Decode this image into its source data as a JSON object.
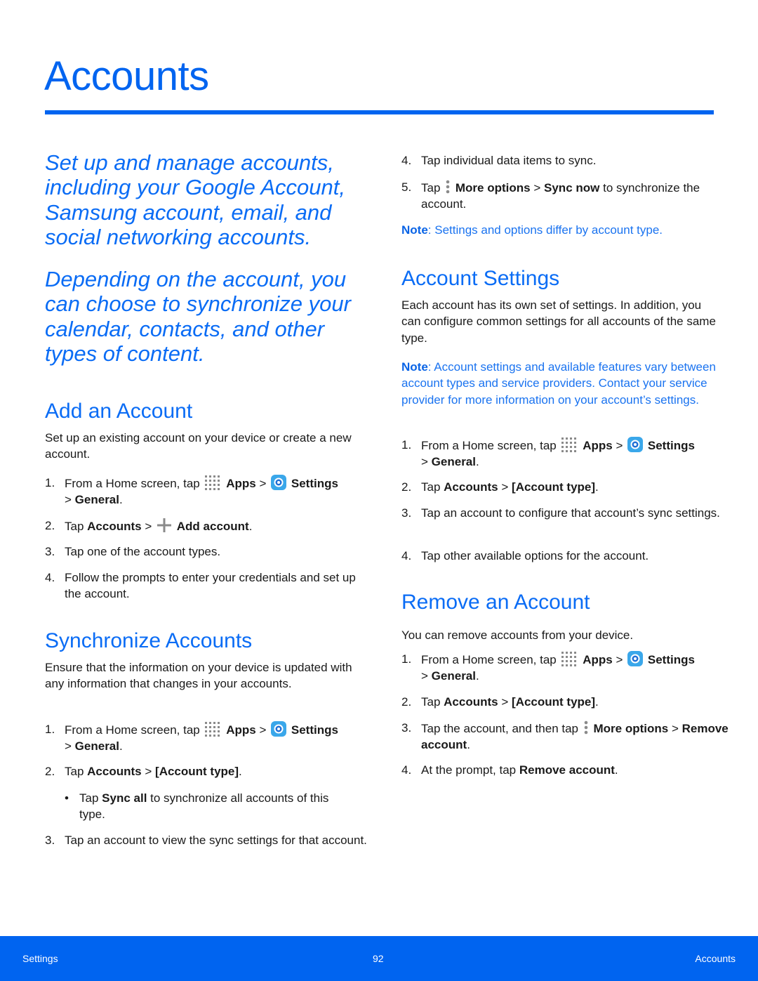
{
  "page": {
    "title": "Accounts",
    "accent_color": "#0064f0",
    "intro": [
      "Set up and manage accounts, including your Google Account, Samsung account, email, and social networking accounts.",
      "Depending on the account, you can choose to synchronize your calendar, contacts, and other types of content."
    ]
  },
  "add_account": {
    "heading": "Add an Account",
    "desc": "Set up an existing account on your device or create a new account.",
    "steps": {
      "s1": {
        "num": "1.",
        "pre": "From a Home screen, tap",
        "apps": "Apps",
        "sep": ">",
        "settings": "Settings",
        "sep2": ">",
        "general": "General",
        "end": "."
      },
      "s2": {
        "num": "2.",
        "pre": "Tap",
        "accounts": "Accounts",
        "sep": ">",
        "add": "Add account",
        "end": "."
      },
      "s3": {
        "num": "3.",
        "text": "Tap one of the account types."
      },
      "s4": {
        "num": "4.",
        "text": "Follow the prompts to enter your credentials and set up the account."
      }
    }
  },
  "sync": {
    "heading": "Synchronize Accounts",
    "desc": "Ensure that the information on your device is updated with any information that changes in your accounts.",
    "steps": {
      "s1": {
        "num": "1.",
        "pre": "From a Home screen, tap",
        "apps": "Apps",
        "sep": ">",
        "settings": "Settings",
        "sep2": ">",
        "general": "General",
        "end": "."
      },
      "s2": {
        "num": "2.",
        "pre": "Tap",
        "accounts": "Accounts",
        "sep": ">",
        "type": "[Account type]",
        "end": "."
      },
      "bullet": {
        "dot": "•",
        "pre": "Tap",
        "bold": "Sync all",
        "post": "to synchronize all accounts of this type."
      },
      "s3": {
        "num": "3.",
        "text": "Tap an account to view the sync settings for that account."
      },
      "s4": {
        "num": "4.",
        "text": "Tap individual data items to sync."
      },
      "s5": {
        "num": "5.",
        "pre": "Tap",
        "more": "More options",
        "sep": ">",
        "sync_now": "Sync now",
        "post": "to synchronize the account."
      }
    },
    "note_label": "Note",
    "note_text": ": Settings and options differ by account type."
  },
  "account_settings": {
    "heading": "Account Settings",
    "desc": "Each account has its own set of settings. In addition, you can configure common settings for all accounts of the same type.",
    "note_label": "Note",
    "note_text": ": Account settings and available features vary between account types and service providers. Contact your service provider for more information on your account’s settings.",
    "steps": {
      "s1": {
        "num": "1.",
        "pre": "From a Home screen, tap",
        "apps": "Apps",
        "sep": ">",
        "settings": "Settings",
        "sep2": ">",
        "general": "General",
        "end": "."
      },
      "s2": {
        "num": "2.",
        "pre": "Tap",
        "accounts": "Accounts",
        "sep": ">",
        "type": "[Account type]",
        "end": "."
      },
      "s3": {
        "num": "3.",
        "text": "Tap an account to configure that account’s sync settings."
      },
      "s4": {
        "num": "4.",
        "text": "Tap other available options for the account."
      }
    }
  },
  "remove_account": {
    "heading": "Remove an Account",
    "desc": "You can remove accounts from your device.",
    "steps": {
      "s1": {
        "num": "1.",
        "pre": "From a Home screen, tap",
        "apps": "Apps",
        "sep": ">",
        "settings": "Settings",
        "sep2": ">",
        "general": "General",
        "end": "."
      },
      "s2": {
        "num": "2.",
        "pre": "Tap",
        "accounts": "Accounts",
        "sep": ">",
        "type": "[Account type]",
        "end": "."
      },
      "s3": {
        "num": "3.",
        "pre": "Tap the account, and then tap",
        "more": "More options",
        "sep": ">",
        "remove": "Remove account",
        "end": "."
      },
      "s4": {
        "num": "4.",
        "pre": "At the prompt, tap",
        "remove": "Remove account",
        "end": "."
      }
    }
  },
  "footer": {
    "left": "Settings",
    "page_number": "92",
    "right": "Accounts"
  }
}
